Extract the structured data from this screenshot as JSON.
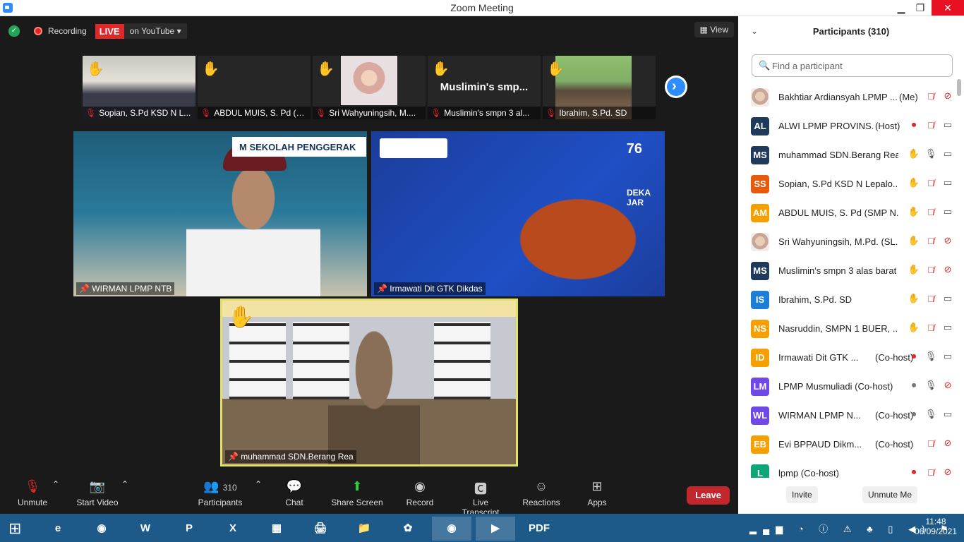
{
  "window": {
    "title": "Zoom Meeting",
    "minimize": "▁",
    "restore": "❐",
    "close": "✕"
  },
  "topbar": {
    "recording_label": "Recording",
    "live_label": "LIVE",
    "youtube_label": "on YouTube ▾",
    "view_label": "View"
  },
  "thumbnails": [
    {
      "name": "Sopian, S.Pd KSD N L...",
      "hand": "✋"
    },
    {
      "name": "ABDUL MUIS, S. Pd (S...",
      "hand": "✋"
    },
    {
      "name": "Sri Wahyuningsih, M....",
      "hand": "✋"
    },
    {
      "name": "Muslimin's smpn 3 al...",
      "hand": "✋",
      "big": "Muslimin's  smp..."
    },
    {
      "name": "Ibrahim, S.Pd. SD",
      "hand": "✋"
    }
  ],
  "tiles": {
    "tile1": {
      "name": "WIRMAN LPMP NTB",
      "banner": "M SEKOLAH PENGGERAK"
    },
    "tile2": {
      "name": "Irmawati Dit GTK Dikdas",
      "big76": "76",
      "merdeka": "DEKA\nJAR"
    },
    "tile3": {
      "name": "muhammad SDN.Berang Rea",
      "hand": "✋"
    }
  },
  "toolbar": {
    "unmute": "Unmute",
    "start_video": "Start Video",
    "participants": "Participants",
    "participants_count": "310",
    "chat": "Chat",
    "share_screen": "Share Screen",
    "record": "Record",
    "live_transcript": "Live Transcript",
    "reactions": "Reactions",
    "apps": "Apps",
    "leave": "Leave"
  },
  "panel": {
    "title": "Participants (310)",
    "search_placeholder": "Find a participant",
    "invite": "Invite",
    "unmute_me": "Unmute Me"
  },
  "participants": [
    {
      "initials": "",
      "photo": true,
      "color": "#8a6f58",
      "name": "Bakhtiar Ardiansyah LPMP ...",
      "tag": "(Me)",
      "hand": false,
      "mic": "off",
      "cam": "off",
      "rec": false
    },
    {
      "initials": "AL",
      "color": "#1f3a5a",
      "name": "ALWI LPMP PROVINS...",
      "tag": "(Host)",
      "hand": false,
      "mic": "off",
      "cam": "on",
      "rec": true
    },
    {
      "initials": "MS",
      "color": "#1f3a5a",
      "name": "muhammad SDN.Berang Rea",
      "tag": "",
      "hand": true,
      "mic": "on",
      "cam": "on",
      "rec": false
    },
    {
      "initials": "SS",
      "color": "#e8590c",
      "name": "Sopian, S.Pd KSD N Lepalo...",
      "tag": "",
      "hand": true,
      "mic": "off",
      "cam": "on",
      "rec": false
    },
    {
      "initials": "AM",
      "color": "#f59f00",
      "name": "ABDUL MUIS, S. Pd (SMP N...",
      "tag": "",
      "hand": true,
      "mic": "off",
      "cam": "on",
      "rec": false
    },
    {
      "initials": "",
      "photo": true,
      "color": "#d9a9a0",
      "name": "Sri Wahyuningsih, M.Pd. (SL...",
      "tag": "",
      "hand": true,
      "mic": "off",
      "cam": "off",
      "rec": false
    },
    {
      "initials": "MS",
      "color": "#1f3a5a",
      "name": "Muslimin's smpn 3 alas barat",
      "tag": "",
      "hand": true,
      "mic": "off",
      "cam": "off",
      "rec": false
    },
    {
      "initials": "IS",
      "color": "#1c7ed6",
      "name": "Ibrahim, S.Pd. SD",
      "tag": "",
      "hand": true,
      "mic": "off",
      "cam": "on",
      "rec": false
    },
    {
      "initials": "NS",
      "color": "#f59f00",
      "name": "Nasruddin, SMPN 1 BUER, ...",
      "tag": "",
      "hand": true,
      "mic": "off",
      "cam": "on",
      "rec": false
    },
    {
      "initials": "ID",
      "color": "#f59f00",
      "name": "Irmawati Dit GTK ...",
      "tag": "(Co-host)",
      "hand": false,
      "mic": "on",
      "cam": "on",
      "rec": true
    },
    {
      "initials": "LM",
      "color": "#7048e8",
      "name": "LPMP Musmuliadi (Co-host)",
      "tag": "",
      "hand": false,
      "mic": "on",
      "cam": "off",
      "rec": true,
      "rec_grey": true
    },
    {
      "initials": "WL",
      "color": "#7048e8",
      "name": "WIRMAN LPMP N...",
      "tag": "(Co-host)",
      "hand": false,
      "mic": "on",
      "cam": "on",
      "rec": true,
      "rec_grey": true
    },
    {
      "initials": "EB",
      "color": "#f59f00",
      "name": "Evi BPPAUD Dikm...",
      "tag": "(Co-host)",
      "hand": false,
      "mic": "off",
      "cam": "off",
      "rec": false
    },
    {
      "initials": "L",
      "color": "#0ca678",
      "name": "lpmp (Co-host)",
      "tag": "",
      "hand": false,
      "mic": "off",
      "cam": "off",
      "rec": true
    }
  ],
  "taskbar": {
    "apps": [
      "e",
      "◉",
      "W",
      "P",
      "X",
      "▦",
      "🖨",
      "📁",
      "✿",
      "◉",
      "▶",
      "PDF"
    ],
    "time": "11:48",
    "date": "06/09/2021"
  }
}
